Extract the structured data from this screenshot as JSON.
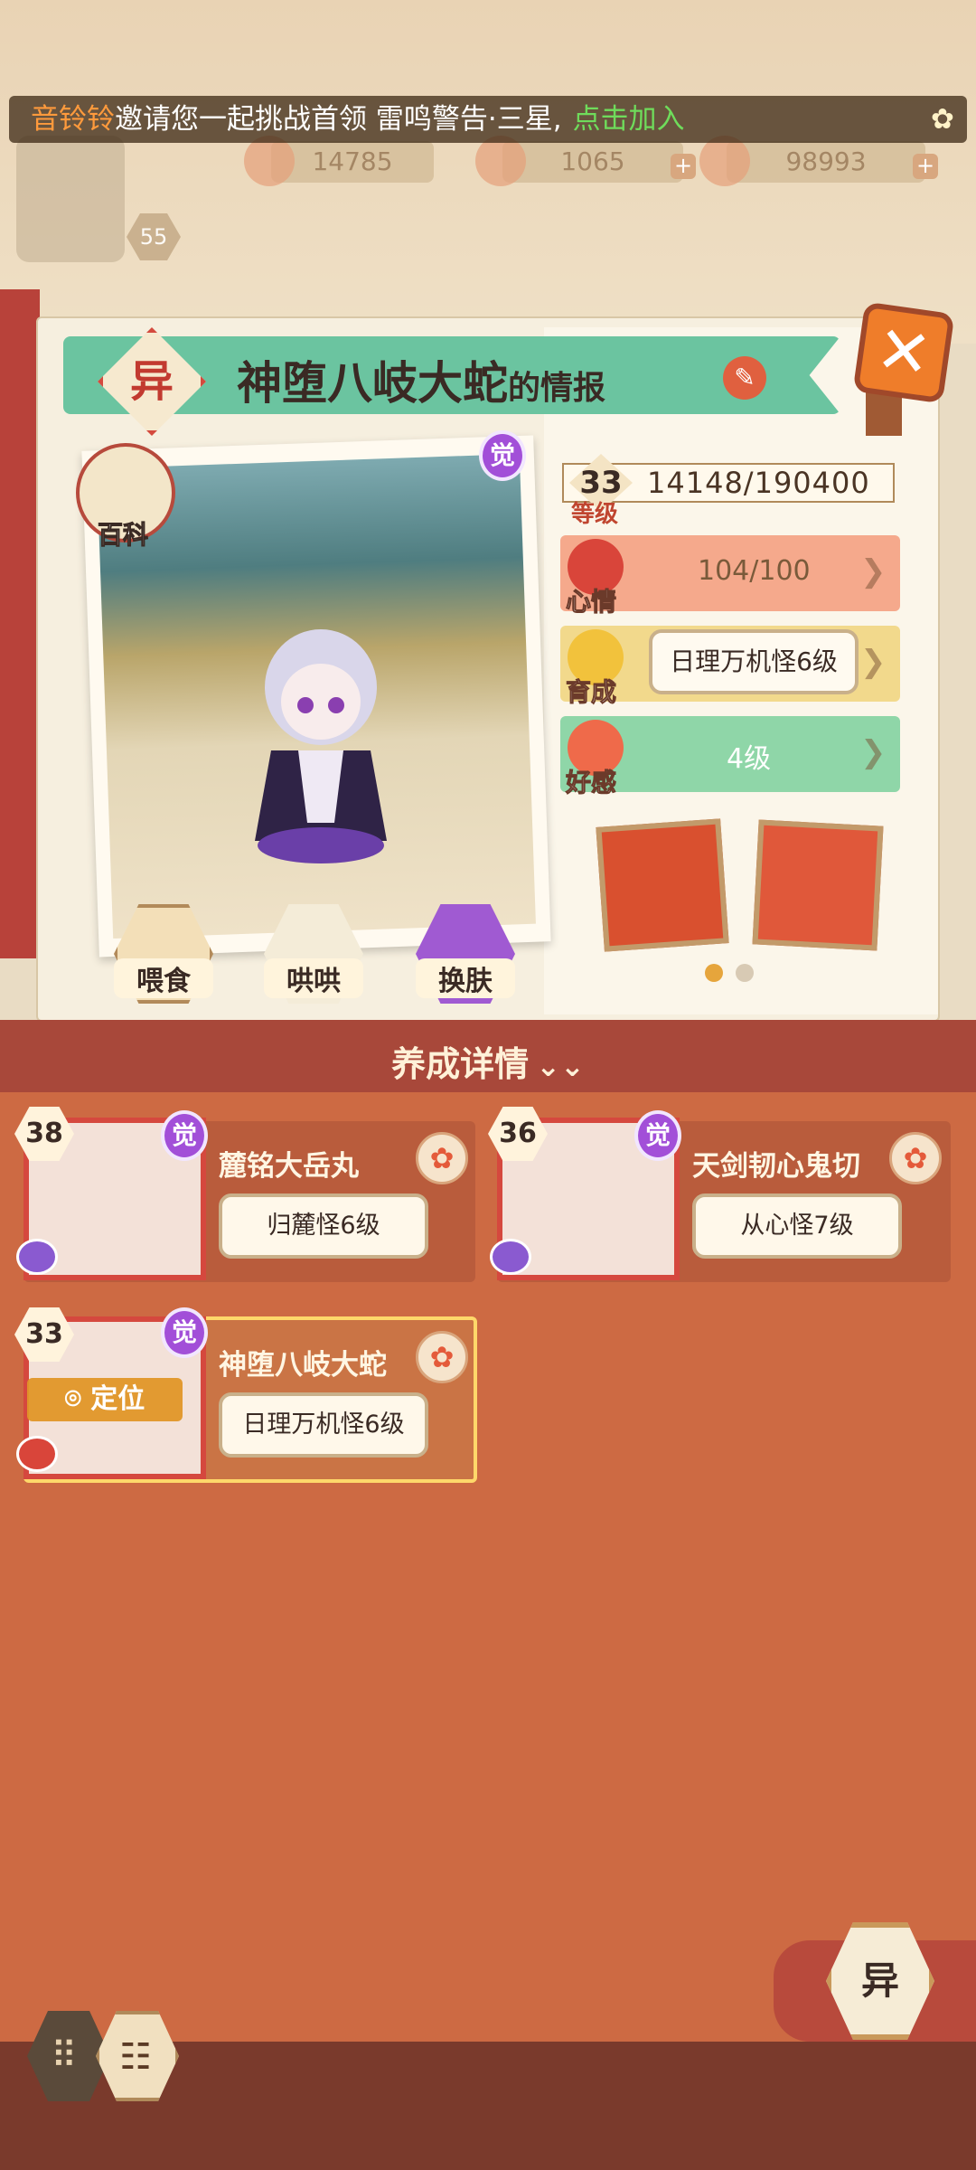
{
  "hud": {
    "invite_name": "音铃铃",
    "invite_text": "邀请您一起挑战首领 雷鸣警告·三星,",
    "invite_join": "点击加入",
    "player_level": "55",
    "resources": [
      {
        "value": "14785"
      },
      {
        "value": "1065"
      },
      {
        "value": "98993"
      }
    ]
  },
  "info": {
    "badge": "异",
    "title_name": "神堕八岐大蛇",
    "title_suffix": "的情报",
    "close_label": "✕",
    "awaken_badge": "觉",
    "encyclopedia_label": "百科",
    "actions": [
      {
        "label": "喂食"
      },
      {
        "label": "哄哄"
      },
      {
        "label": "换肤"
      }
    ],
    "level": {
      "value": "33",
      "exp": "14148/190400",
      "label": "等级"
    },
    "mood": {
      "label": "心情",
      "value": "104/100"
    },
    "growth": {
      "label": "育成",
      "value": "日理万机怪6级"
    },
    "affinity": {
      "label": "好感",
      "value": "4级"
    }
  },
  "details_label": "养成详情",
  "shikigami": [
    {
      "level": "38",
      "awaken": "觉",
      "name": "麓铭大岳丸",
      "growth": "归麓怪6级",
      "selected": false
    },
    {
      "level": "36",
      "awaken": "觉",
      "name": "天剑韧心鬼切",
      "growth": "从心怪7级",
      "selected": false
    },
    {
      "level": "33",
      "awaken": "觉",
      "name": "神堕八岐大蛇",
      "growth": "日理万机怪6级",
      "selected": true,
      "locate_label": "定位"
    }
  ],
  "bottom": {
    "yi_button": "异"
  },
  "colors": {
    "accent_red": "#d5483e",
    "body_orange": "#cd6a43",
    "title_green": "#6bc4a0",
    "awaken_purple": "#a24fd8"
  }
}
